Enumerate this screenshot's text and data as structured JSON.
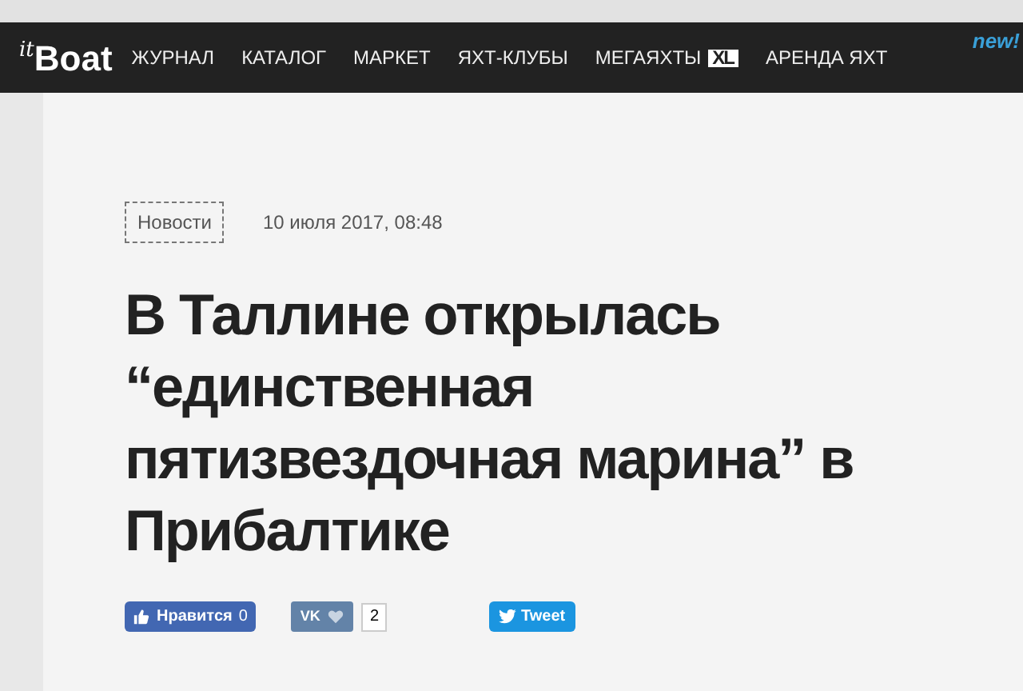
{
  "nav": {
    "logo_small": "it",
    "logo_main": "Boat",
    "items": [
      {
        "label": "ЖУРНАЛ"
      },
      {
        "label": "КАТАЛОГ"
      },
      {
        "label": "МАРКЕТ"
      },
      {
        "label": "ЯХТ-КЛУБЫ"
      },
      {
        "label": "МЕГАЯХТЫ",
        "badge": "XL"
      },
      {
        "label": "АРЕНДА ЯХТ",
        "badge_new": "new!"
      }
    ]
  },
  "article": {
    "category": "Новости",
    "date": "10 июля 2017, 08:48",
    "title": "В Таллине открылась “единственная пятизвездочная марина” в Прибалтике"
  },
  "share": {
    "facebook": {
      "label": "Нравится",
      "count": "0"
    },
    "vk": {
      "logo": "VK",
      "count": "2"
    },
    "twitter": {
      "label": "Tweet"
    }
  }
}
